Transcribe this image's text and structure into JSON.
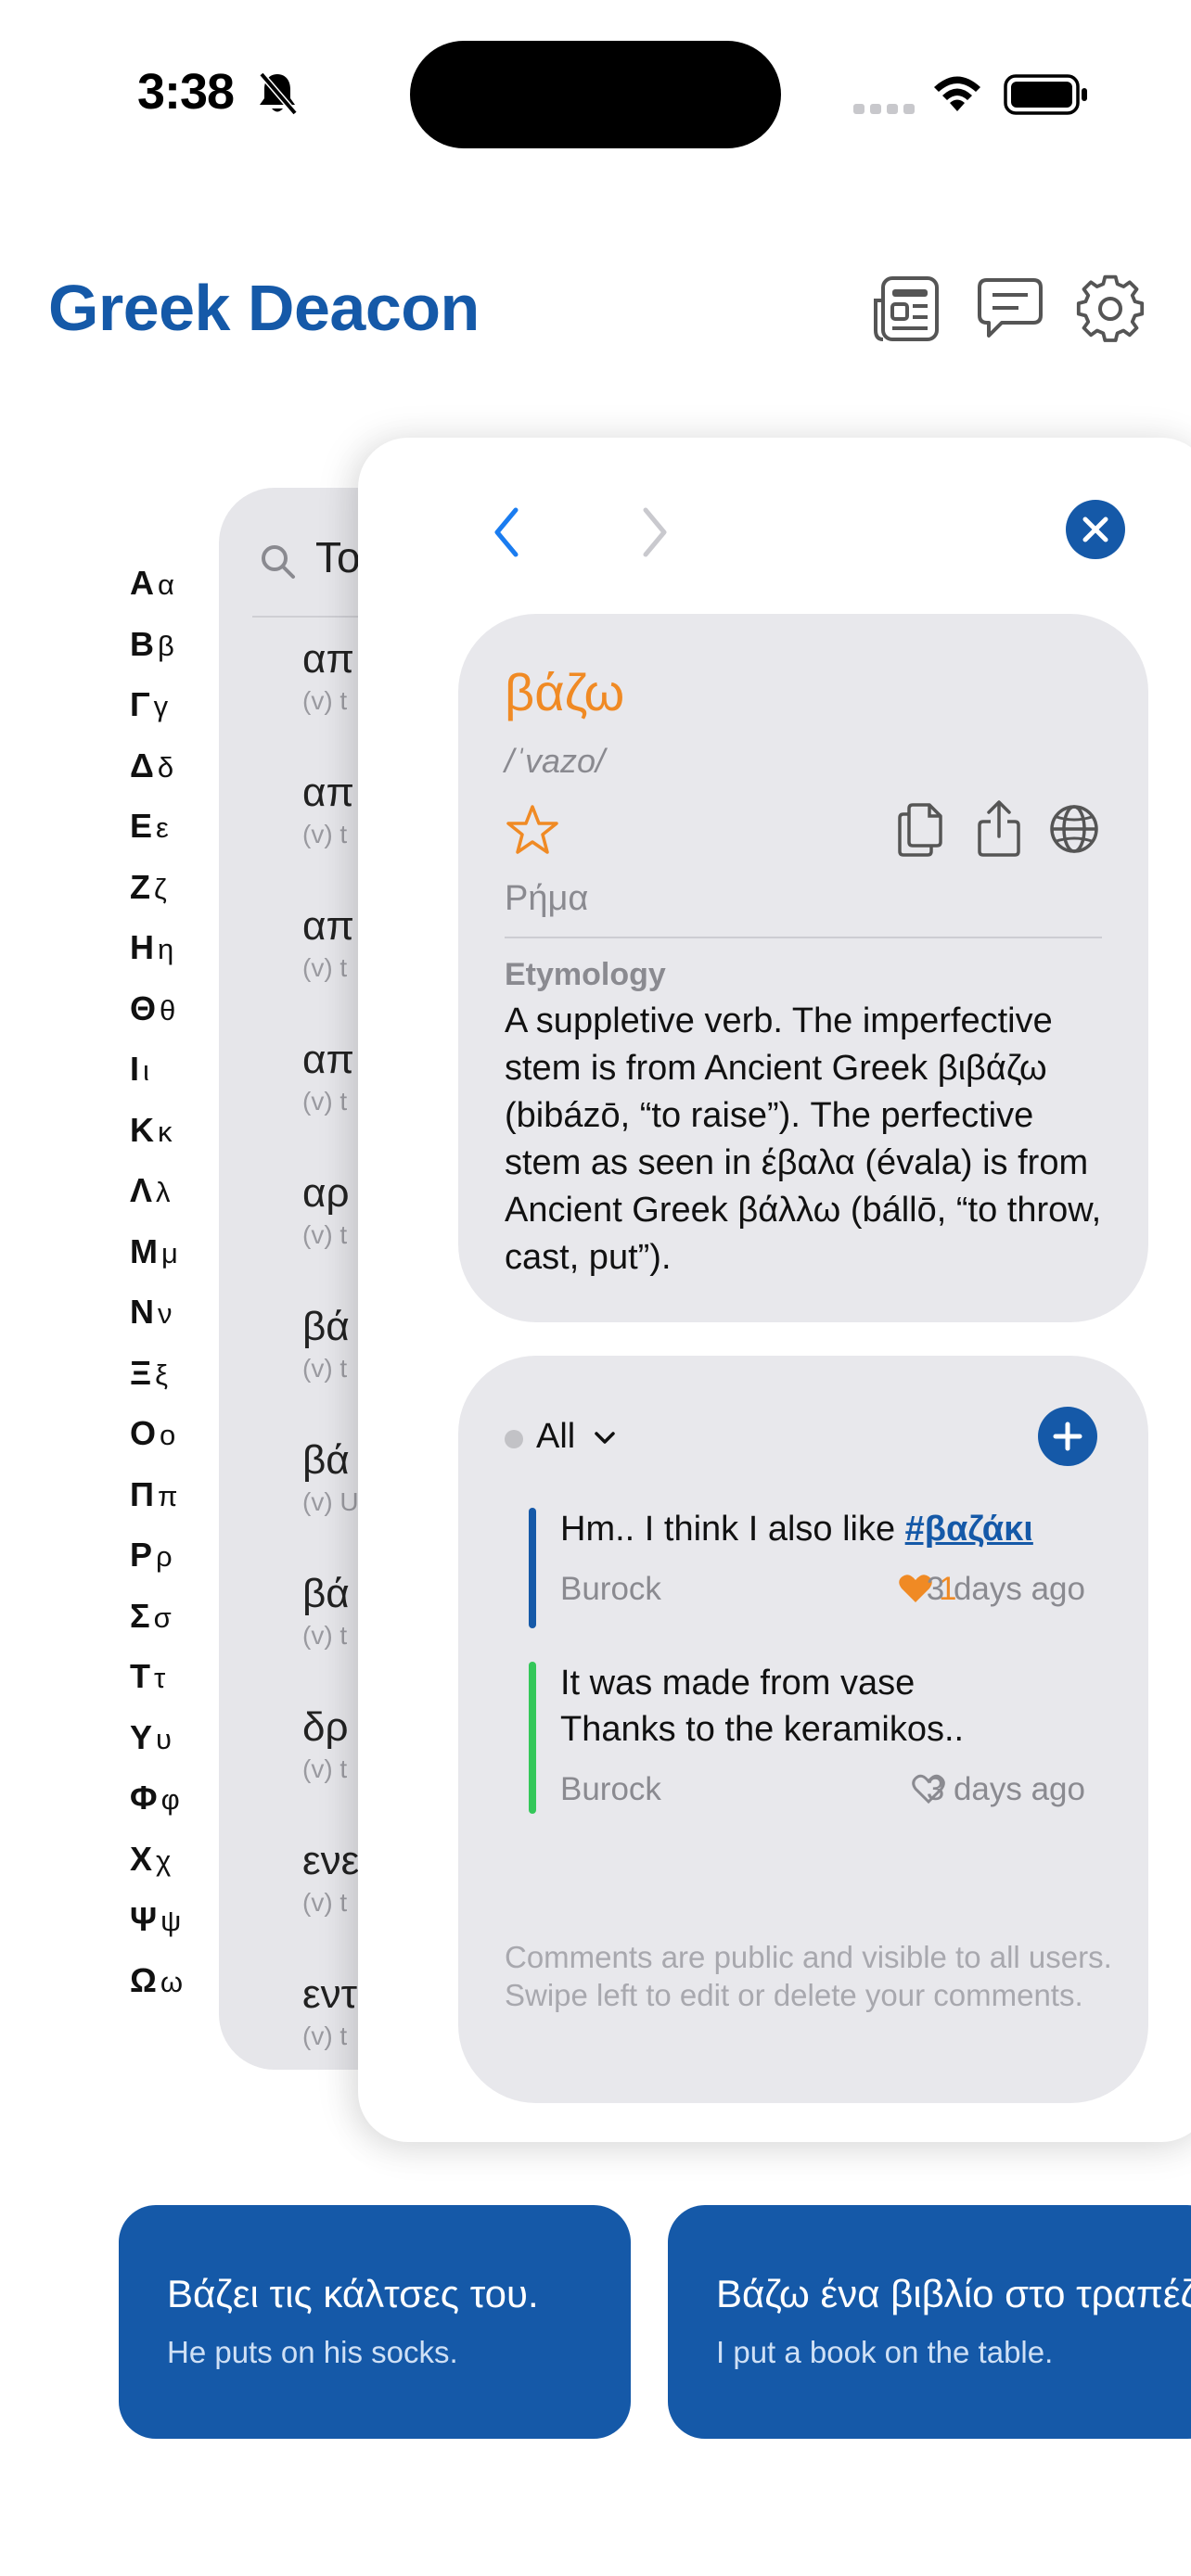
{
  "status_bar": {
    "time": "3:38"
  },
  "header": {
    "title": "Greek Deacon",
    "icons": [
      "newspaper-icon",
      "chat-bubble-icon",
      "gear-icon"
    ]
  },
  "alphabet": [
    {
      "upper": "Α",
      "lower": "α"
    },
    {
      "upper": "Β",
      "lower": "β"
    },
    {
      "upper": "Γ",
      "lower": "γ"
    },
    {
      "upper": "Δ",
      "lower": "δ"
    },
    {
      "upper": "Ε",
      "lower": "ε"
    },
    {
      "upper": "Ζ",
      "lower": "ζ"
    },
    {
      "upper": "Η",
      "lower": "η"
    },
    {
      "upper": "Θ",
      "lower": "θ"
    },
    {
      "upper": "Ι",
      "lower": "ι"
    },
    {
      "upper": "Κ",
      "lower": "κ"
    },
    {
      "upper": "Λ",
      "lower": "λ"
    },
    {
      "upper": "Μ",
      "lower": "μ"
    },
    {
      "upper": "Ν",
      "lower": "ν"
    },
    {
      "upper": "Ξ",
      "lower": "ξ"
    },
    {
      "upper": "Ο",
      "lower": "ο"
    },
    {
      "upper": "Π",
      "lower": "π"
    },
    {
      "upper": "Ρ",
      "lower": "ρ"
    },
    {
      "upper": "Σ",
      "lower": "σ"
    },
    {
      "upper": "Τ",
      "lower": "τ"
    },
    {
      "upper": "Υ",
      "lower": "υ"
    },
    {
      "upper": "Φ",
      "lower": "φ"
    },
    {
      "upper": "Χ",
      "lower": "χ"
    },
    {
      "upper": "Ψ",
      "lower": "ψ"
    },
    {
      "upper": "Ω",
      "lower": "ω"
    }
  ],
  "list": {
    "search_text": "To",
    "rows": [
      {
        "word": "απ",
        "sub": "(v) t"
      },
      {
        "word": "απ",
        "sub": "(v) t"
      },
      {
        "word": "απ",
        "sub": "(v) t"
      },
      {
        "word": "απ",
        "sub": "(v) t"
      },
      {
        "word": "αρ",
        "sub": "(v) t"
      },
      {
        "word": "βά",
        "sub": "(v) t"
      },
      {
        "word": "βά",
        "sub": "(v) U"
      },
      {
        "word": "βά",
        "sub": "(v) t"
      },
      {
        "word": "δρ",
        "sub": "(v) t"
      },
      {
        "word": "ενε",
        "sub": "(v) t"
      },
      {
        "word": "εντ",
        "sub": "(v) t"
      }
    ]
  },
  "word": {
    "title": "βάζω",
    "ipa": "/ˈvazo/",
    "pos": "Ρήμα",
    "etymology_label": "Etymology",
    "etymology": "A suppletive verb. The imperfective stem is from Ancient Greek βιβάζω (bibázō, “to raise”). The perfective stem as seen in έβαλα (évala) is from Ancient Greek βάλλω (bállō, “to throw, cast, put”)."
  },
  "comments": {
    "filter": "All",
    "items": [
      {
        "line1": "Hm.. I think I also like ",
        "tag": "#βαζάκι",
        "author": "Burock",
        "likes": "1",
        "liked": true,
        "time": "3 days ago",
        "color": "#1559a8"
      },
      {
        "line1": "It was made from vase",
        "line2": "Thanks to the keramikos..",
        "author": "Burock",
        "likes": "",
        "liked": false,
        "time": "3 days ago",
        "color": "#34c759"
      }
    ],
    "note": "Comments are public and visible to all users. Swipe left to edit or delete your comments."
  },
  "examples": [
    {
      "greek": "Βάζει τις κάλτσες του.",
      "english": "He puts on his socks."
    },
    {
      "greek": "Βάζω ένα βιβλίο στο τραπέζι.",
      "english": "I put a book on the table."
    }
  ],
  "colors": {
    "brand_blue": "#1559a8",
    "accent_orange": "#f08a24",
    "nav_blue": "#1a7cf0",
    "card_gray": "#e8e8ec"
  }
}
